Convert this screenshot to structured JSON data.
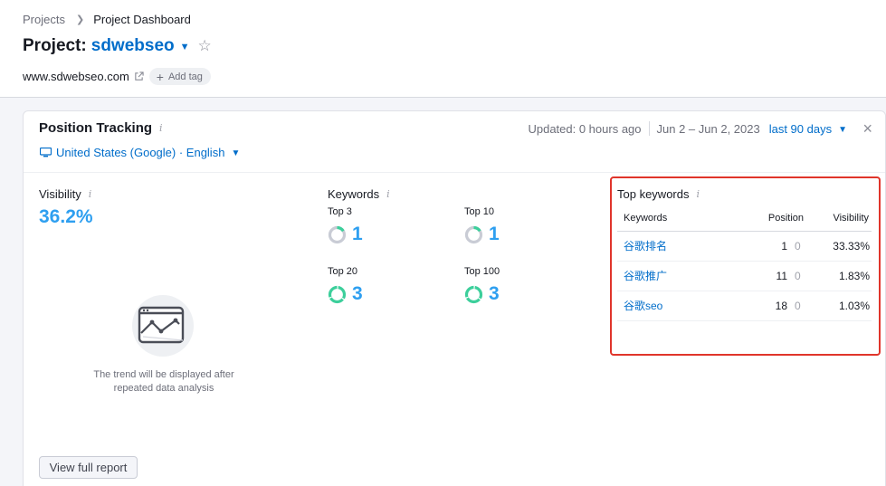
{
  "breadcrumb": {
    "root": "Projects",
    "current": "Project Dashboard"
  },
  "project": {
    "prefix": "Project:",
    "name": "sdwebseo",
    "domain": "www.sdwebseo.com",
    "add_tag": "Add tag"
  },
  "widget": {
    "title": "Position Tracking",
    "info": "i",
    "location": "United States (Google) · English",
    "updated": "Updated: 0 hours ago",
    "date_range": "Jun 2 – Jun 2, 2023",
    "period": "last 90 days",
    "close": "×"
  },
  "visibility": {
    "label": "Visibility",
    "value": "36.2%",
    "empty_text": "The trend will be displayed after repeated data analysis"
  },
  "keywords": {
    "label": "Keywords",
    "top3": {
      "label": "Top 3",
      "value": "1"
    },
    "top10": {
      "label": "Top 10",
      "value": "1"
    },
    "top20": {
      "label": "Top 20",
      "value": "3"
    },
    "top100": {
      "label": "Top 100",
      "value": "3"
    }
  },
  "top_keywords": {
    "title": "Top keywords",
    "columns": [
      "Keywords",
      "Position",
      "Visibility"
    ],
    "rows": [
      {
        "keyword": "谷歌排名",
        "position": "1",
        "diff": "0",
        "visibility": "33.33%"
      },
      {
        "keyword": "谷歌推广",
        "position": "11",
        "diff": "0",
        "visibility": "1.83%"
      },
      {
        "keyword": "谷歌seo",
        "position": "18",
        "diff": "0",
        "visibility": "1.03%"
      }
    ]
  },
  "buttons": {
    "full_report": "View full report"
  },
  "colors": {
    "accent": "#006dca",
    "metric": "#2e9ff0",
    "green": "#3ccf9b",
    "gray": "#c9ccd5",
    "highlight": "#e0352b"
  },
  "icons": [
    "chevron-right-icon",
    "chevron-down-icon",
    "star-icon",
    "external-link-icon",
    "plus-icon",
    "info-icon",
    "monitor-icon",
    "close-icon",
    "chart-illustration"
  ]
}
